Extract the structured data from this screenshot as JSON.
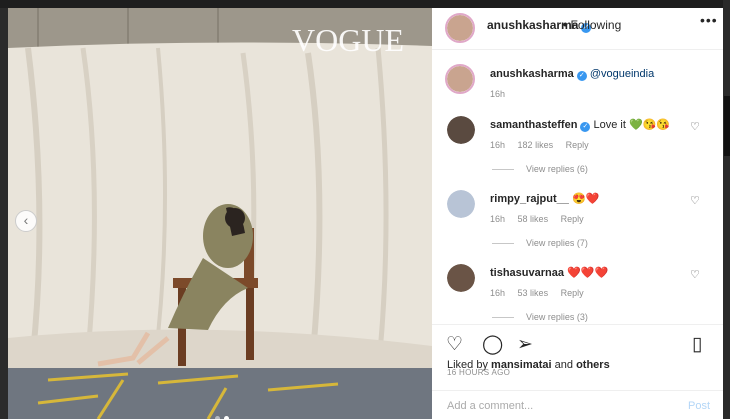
{
  "post": {
    "magazine_logo": "VOGUE",
    "carousel": {
      "current": 2,
      "total": 2
    }
  },
  "header": {
    "username": "anushkasharma",
    "separator": "•",
    "follow_status": "Following",
    "more": "•••"
  },
  "caption": {
    "username": "anushkasharma",
    "mention": "@vogueindia",
    "time": "16h"
  },
  "comments": [
    {
      "username": "samanthasteffen",
      "verified": true,
      "text": "Love it 💚😘😘",
      "time": "16h",
      "likes": "182 likes",
      "reply": "Reply",
      "view_replies": "View replies (6)"
    },
    {
      "username": "rimpy_rajput__",
      "verified": false,
      "text": "😍❤️",
      "time": "16h",
      "likes": "58 likes",
      "reply": "Reply",
      "view_replies": "View replies (7)"
    },
    {
      "username": "tishasuvarnaa",
      "verified": false,
      "text": "❤️❤️❤️",
      "time": "16h",
      "likes": "53 likes",
      "reply": "Reply",
      "view_replies": "View replies (3)"
    }
  ],
  "likes": {
    "prefix": "Liked by",
    "user": "mansimatai",
    "and": "and",
    "others": "others"
  },
  "timestamp": "16 HOURS AGO",
  "add_comment": {
    "placeholder": "Add a comment...",
    "post_label": "Post"
  },
  "colors": {
    "verified": "#3897f0",
    "link": "#00376b",
    "heart": "#ed4956"
  },
  "icons": [
    "chevron-left-icon",
    "heart-icon",
    "comment-icon",
    "share-icon",
    "bookmark-icon",
    "verified-icon"
  ]
}
